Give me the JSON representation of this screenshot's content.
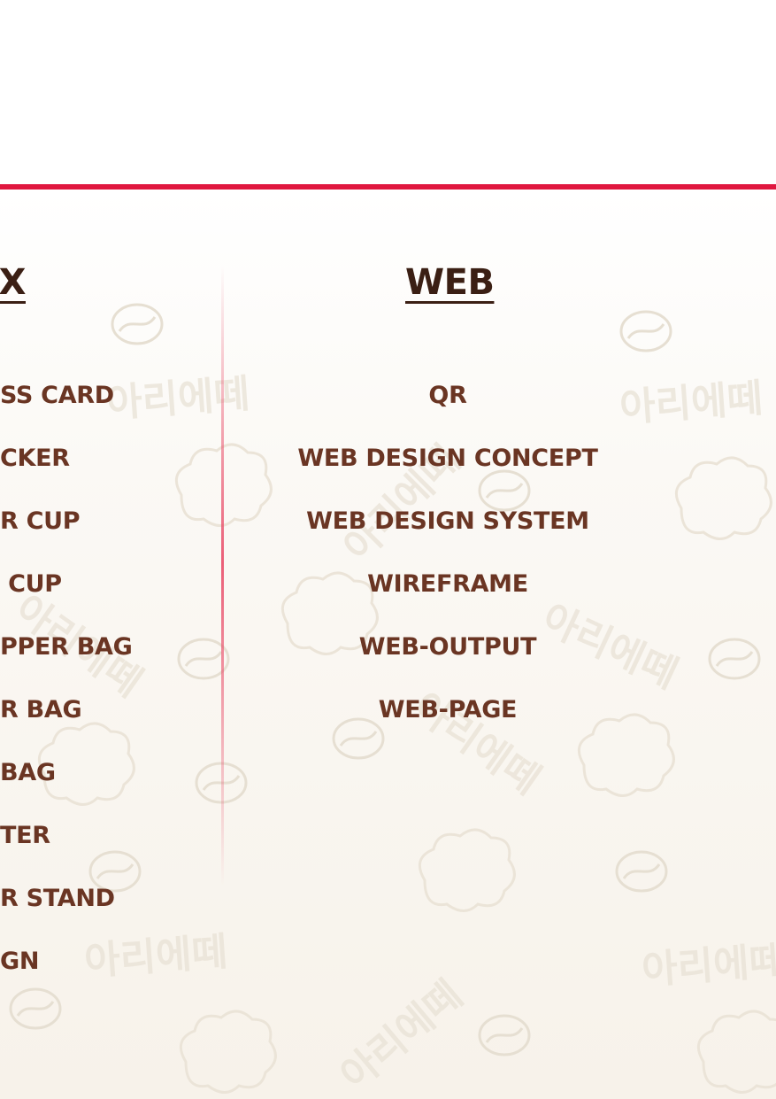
{
  "colors": {
    "accent_rule": "#e0173f",
    "heading_text": "#3b1f14",
    "item_text": "#6a3523",
    "watermark": "#e9e2d6"
  },
  "watermark_text": "아리에떼",
  "columns": {
    "left": {
      "heading": "X",
      "items": [
        "SS CARD",
        "CKER",
        "R CUP",
        " CUP",
        "PPER BAG",
        "R BAG",
        "BAG",
        "TER",
        "R STAND",
        "GN"
      ]
    },
    "web": {
      "heading": "WEB",
      "items": [
        "QR",
        "WEB DESIGN CONCEPT",
        "WEB DESIGN SYSTEM",
        "WIREFRAME",
        "WEB-OUTPUT",
        "WEB-PAGE"
      ]
    }
  }
}
